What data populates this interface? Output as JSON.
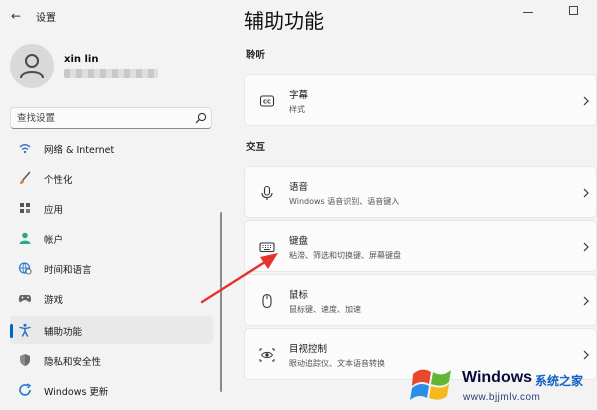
{
  "window": {
    "title": "设置",
    "back_icon": "back-arrow-icon",
    "minimize_icon": "minimize-icon",
    "maximize_icon": "maximize-icon"
  },
  "user": {
    "name": "xin lin",
    "email_blurred": true
  },
  "search": {
    "placeholder": "查找设置",
    "icon": "search-icon"
  },
  "nav": {
    "items": [
      {
        "label": "网络 & Internet",
        "icon": "network-icon",
        "color": "#3a78c2"
      },
      {
        "label": "个性化",
        "icon": "brush-icon",
        "color": "#e07b3c"
      },
      {
        "label": "应用",
        "icon": "apps-icon",
        "color": "#555555"
      },
      {
        "label": "帐户",
        "icon": "account-icon",
        "color": "#2ca58d"
      },
      {
        "label": "时间和语言",
        "icon": "globe-clock-icon",
        "color": "#2f7fd0"
      },
      {
        "label": "游戏",
        "icon": "gamepad-icon",
        "color": "#666666"
      },
      {
        "label": "辅助功能",
        "icon": "accessibility-icon",
        "color": "#1f6fc5",
        "selected": true
      },
      {
        "label": "隐私和安全性",
        "icon": "shield-icon",
        "color": "#777777"
      },
      {
        "label": "Windows 更新",
        "icon": "windows-update-icon",
        "color": "#1f78d1"
      }
    ]
  },
  "main": {
    "title": "辅助功能",
    "sections": [
      {
        "header": "聆听",
        "cards": [
          {
            "title": "字幕",
            "subtitle": "样式",
            "icon": "captions-icon"
          }
        ]
      },
      {
        "header": "交互",
        "cards": [
          {
            "title": "语音",
            "subtitle": "Windows 语音识别、语音键入",
            "icon": "microphone-icon"
          },
          {
            "title": "键盘",
            "subtitle": "粘滞、筛选和切换键、屏幕键盘",
            "icon": "keyboard-icon"
          },
          {
            "title": "鼠标",
            "subtitle": "鼠标键、速度、加速",
            "icon": "mouse-icon"
          },
          {
            "title": "目视控制",
            "subtitle": "眼动追踪仪、文本语音转换",
            "icon": "eye-control-icon"
          }
        ]
      }
    ]
  },
  "annotation": {
    "type": "red-arrow",
    "color": "#e5322d",
    "target": "键盘"
  },
  "watermark": {
    "brand": "Windows",
    "site_name": "系统之家",
    "url": "www.bjjmlv.com",
    "logo_icon": "windows-logo-icon"
  },
  "colors": {
    "accent": "#0067c0",
    "background": "#f3f3f3",
    "card": "#fbfbfb"
  }
}
